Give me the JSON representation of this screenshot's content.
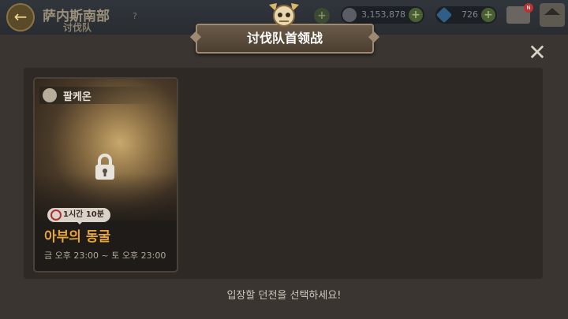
{
  "background": {
    "title": "萨内斯南部",
    "subtitle": "讨伐队",
    "help_label": "?",
    "gold": "3,153,878",
    "gems": "726",
    "mail_badge": "N",
    "back_icon": "back-arrow-icon",
    "home_icon": "home-icon"
  },
  "modal": {
    "title": "讨伐队首领战",
    "close_label": "✕",
    "hint": "입장할 던전을 선택하세요!"
  },
  "card": {
    "attribute": "팔케온",
    "time_badge": "1시간 10분",
    "name": "아부의 동굴",
    "schedule": "금 오후 23:00 ~ 토 오후 23:00",
    "locked": true
  },
  "colors": {
    "accent_orange": "#e6a43a",
    "panel": "#2e2925",
    "modal_bg": "#3a3530"
  }
}
